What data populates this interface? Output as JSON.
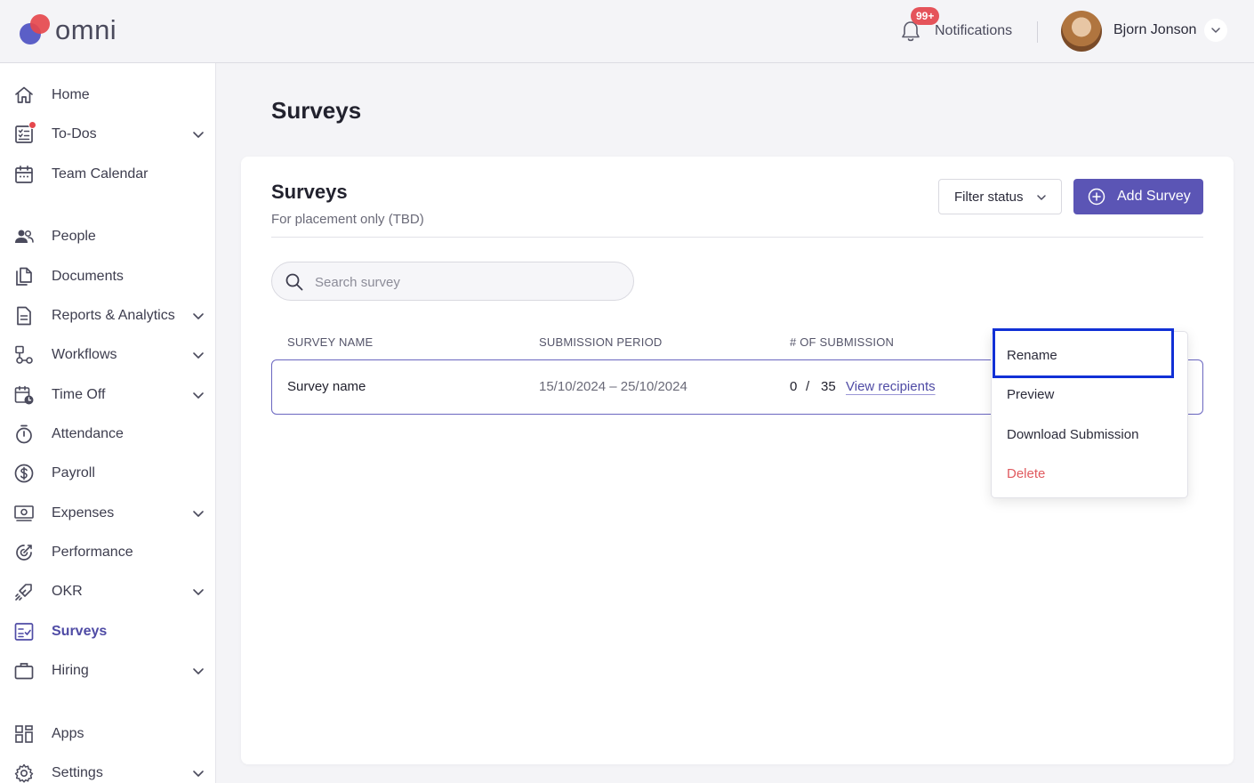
{
  "brand": {
    "name": "omni"
  },
  "header": {
    "notifications_label": "Notifications",
    "notifications_badge": "99+",
    "user_name": "Bjorn Jonson"
  },
  "sidebar": {
    "items": [
      {
        "label": "Home",
        "icon": "home-icon",
        "has_chevron": false
      },
      {
        "label": "To-Dos",
        "icon": "checklist-icon",
        "has_chevron": true,
        "has_dot": true
      },
      {
        "label": "Team Calendar",
        "icon": "calendar-icon",
        "has_chevron": false
      },
      {
        "label": "People",
        "icon": "people-icon",
        "has_chevron": false
      },
      {
        "label": "Documents",
        "icon": "documents-icon",
        "has_chevron": false
      },
      {
        "label": "Reports & Analytics",
        "icon": "report-icon",
        "has_chevron": true
      },
      {
        "label": "Workflows",
        "icon": "workflow-icon",
        "has_chevron": true
      },
      {
        "label": "Time Off",
        "icon": "time-off-icon",
        "has_chevron": true
      },
      {
        "label": "Attendance",
        "icon": "stopwatch-icon",
        "has_chevron": false
      },
      {
        "label": "Payroll",
        "icon": "dollar-icon",
        "has_chevron": false
      },
      {
        "label": "Expenses",
        "icon": "money-icon",
        "has_chevron": true
      },
      {
        "label": "Performance",
        "icon": "performance-icon",
        "has_chevron": false
      },
      {
        "label": "OKR",
        "icon": "rocket-icon",
        "has_chevron": true
      },
      {
        "label": "Surveys",
        "icon": "survey-icon",
        "has_chevron": false,
        "active": true
      },
      {
        "label": "Hiring",
        "icon": "briefcase-icon",
        "has_chevron": true
      },
      {
        "label": "Apps",
        "icon": "apps-grid-icon",
        "has_chevron": false
      },
      {
        "label": "Settings",
        "icon": "gear-icon",
        "has_chevron": true
      }
    ]
  },
  "main": {
    "page_title": "Surveys",
    "card": {
      "title": "Surveys",
      "subtitle": "For placement only (TBD)",
      "filter_label": "Filter status",
      "add_label": "Add Survey",
      "search_placeholder": "Search survey",
      "search_value": ""
    },
    "table": {
      "headers": [
        "SURVEY NAME",
        "SUBMISSION PERIOD",
        "# OF SUBMISSION"
      ],
      "rows": [
        {
          "name": "Survey name",
          "period": "15/10/2024 – 25/10/2024",
          "submitted": "0",
          "separator": "/",
          "total": "35",
          "link": "View recipients"
        }
      ]
    },
    "context_menu": {
      "items": [
        {
          "label": "Rename",
          "focused": true
        },
        {
          "label": "Preview"
        },
        {
          "label": "Download Submission"
        },
        {
          "label": "Delete",
          "danger": true
        }
      ]
    }
  },
  "colors": {
    "accent": "#5b55b5",
    "danger": "#e05a5f",
    "badge": "#e5535a",
    "focus_outline": "#1130d6"
  }
}
